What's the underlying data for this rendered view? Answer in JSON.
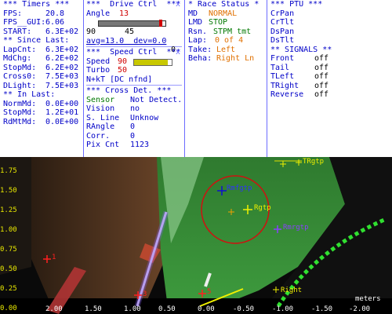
{
  "timers": {
    "title": "*** Timers ***",
    "fps_label": "FPS:",
    "fps": "20.8",
    "fps_gui_label": "FPS__GUI:",
    "fps_gui": "6.06",
    "start_label": "START:",
    "start": "6.3E+02",
    "since_title": "** Since Last:",
    "lapcnt_label": "LapCnt:",
    "lapcnt": "6.3E+02",
    "mdchg_label": "MdChg:",
    "mdchg": "6.2E+02",
    "stopmd_label": "StopMd:",
    "stopmd": "6.2E+02",
    "cross0_label": "Cross0:",
    "cross0": "7.5E+03",
    "dlight_label": "DLight:",
    "dlight": "7.5E+03",
    "in_title": "** In Last:",
    "normmd_label": "NormMd:",
    "normmd": "0.0E+00",
    "stopmd2_label": "StopMd:",
    "stopmd2": "1.2E+01",
    "rdmtmd_label": "RdMtMd:",
    "rdmtmd": "0.0E+00"
  },
  "drive": {
    "title": "***  Drive Ctrl  ***",
    "close": "x",
    "angle_label": "Angle",
    "angle": "13",
    "slider_min": "90",
    "slider_max": "0",
    "slider_value": "45",
    "slider_level": 0.93,
    "avg": "avg=13.0  dev=0.0",
    "speed_title": "***  Speed Ctrl  ***",
    "speed_label": "Speed",
    "speed": "90",
    "speed_level": 0.9,
    "turbo_label": "Turbo",
    "turbo": "50",
    "nkt": "N+kT [DC nfnd]",
    "cross_title": "*** Cross Det. ***",
    "sensor_label": "Sensor",
    "sensor": "Not Detect.",
    "vision_label": "Vision",
    "vision": "no",
    "sline_label": "S. Line",
    "sline": "Unknow",
    "rangle_label": "RAngle",
    "rangle": "0",
    "corr_label": "Corr.",
    "corr": "0",
    "pixcnt_label": "Pix Cnt",
    "pixcnt": "1123"
  },
  "race": {
    "title": "* Race Status *",
    "md_label": "MD",
    "md": "NORMAL",
    "lmd_label": "LMD",
    "lmd": "STOP",
    "rsn_label": "Rsn.",
    "rsn": "STPM tmt",
    "lap_label": "Lap:",
    "lap": "0 of 4",
    "take_label": "Take:",
    "take": "Left",
    "beha_label": "Beha:",
    "beha": "Right Ln"
  },
  "ptu": {
    "title": "*** PTU ***",
    "items": [
      "CrPan",
      "CrTlt",
      "DsPan",
      "DsTlt"
    ],
    "signals_title": "** SIGNALS **",
    "signals": [
      {
        "label": "Front",
        "value": "off"
      },
      {
        "label": "Tail",
        "value": "off"
      },
      {
        "label": "TLeft",
        "value": "off"
      },
      {
        "label": "TRight",
        "value": "off"
      },
      {
        "label": "Reverse",
        "value": "off"
      }
    ]
  },
  "scene": {
    "y_labels": [
      "1.75",
      "1.50",
      "1.25",
      "1.00",
      "0.75",
      "0.50",
      "0.25",
      "0.00"
    ],
    "x_labels": [
      "2.00",
      "1.50",
      "1.00",
      "0.50",
      "0.00",
      "-0.50",
      "-1.00",
      "-1.50",
      "-2.00"
    ],
    "units": "meters",
    "markers": {
      "rmfgtp": "Rmfgtp",
      "rgtp": "Rgtp",
      "trgtp": "TRgtp",
      "rmrgtp": "Rmrgtp",
      "right": "Right",
      "m1": "1",
      "m3": "3",
      "m5": "5"
    }
  }
}
